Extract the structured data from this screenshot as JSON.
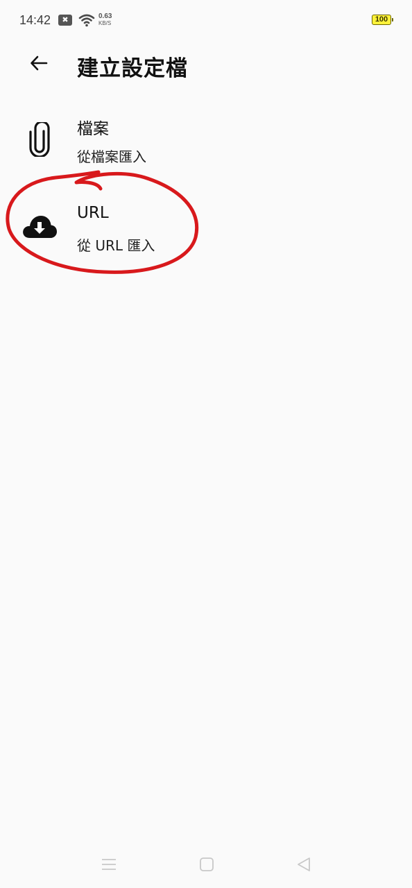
{
  "status_bar": {
    "time": "14:42",
    "notification_badge": "✖",
    "net_speed_value": "0.63",
    "net_speed_unit": "KB/S",
    "battery_level": "100",
    "battery_color": "#fff23a"
  },
  "app_bar": {
    "title": "建立設定檔",
    "back_icon": "arrow-back-icon"
  },
  "items": [
    {
      "title": "檔案",
      "subtitle": "從檔案匯入",
      "icon": "paperclip-icon"
    },
    {
      "title": "URL",
      "subtitle": "從 URL 匯入",
      "icon": "cloud-download-icon"
    }
  ],
  "annotation": {
    "color": "#d8191c",
    "shape": "hand-drawn circle around URL item"
  },
  "nav_bar": {
    "icons": [
      "menu-icon",
      "home-icon",
      "back-triangle-icon"
    ]
  }
}
